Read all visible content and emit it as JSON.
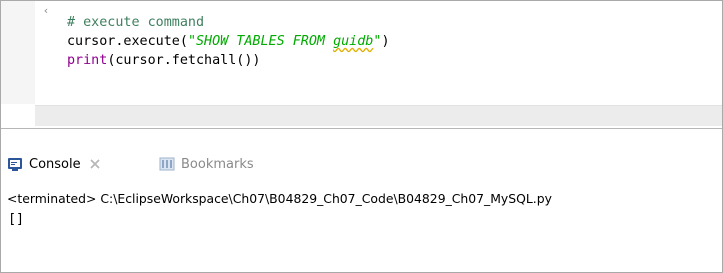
{
  "editor": {
    "code_lines": [
      [
        {
          "text": "# execute command",
          "kind": "comment"
        }
      ],
      [
        {
          "text": "cursor.execute(",
          "kind": "plain"
        },
        {
          "text": "\"SHOW TABLES FROM ",
          "kind": "string"
        },
        {
          "text": "guidb",
          "kind": "string-underlined"
        },
        {
          "text": "\"",
          "kind": "string"
        },
        {
          "text": ")",
          "kind": "plain"
        }
      ],
      [
        {
          "text": "print",
          "kind": "builtin"
        },
        {
          "text": "(cursor.fetchall())",
          "kind": "plain"
        }
      ]
    ],
    "scroll_left_arrow": "‹"
  },
  "console_view": {
    "tabs": [
      {
        "label": "Console",
        "icon": "console-icon",
        "active": true,
        "close_icon": "close-icon"
      },
      {
        "label": "Bookmarks",
        "icon": "bookmarks-icon",
        "active": false
      }
    ],
    "status_line": "<terminated> C:\\EclipseWorkspace\\Ch07\\B04829_Ch07_Code\\B04829_Ch07_MySQL.py",
    "output": "[]"
  },
  "colors": {
    "comment": "#3f7f5f",
    "string": "#00aa00",
    "builtin": "#900090",
    "console_icon": "#2b579a"
  }
}
